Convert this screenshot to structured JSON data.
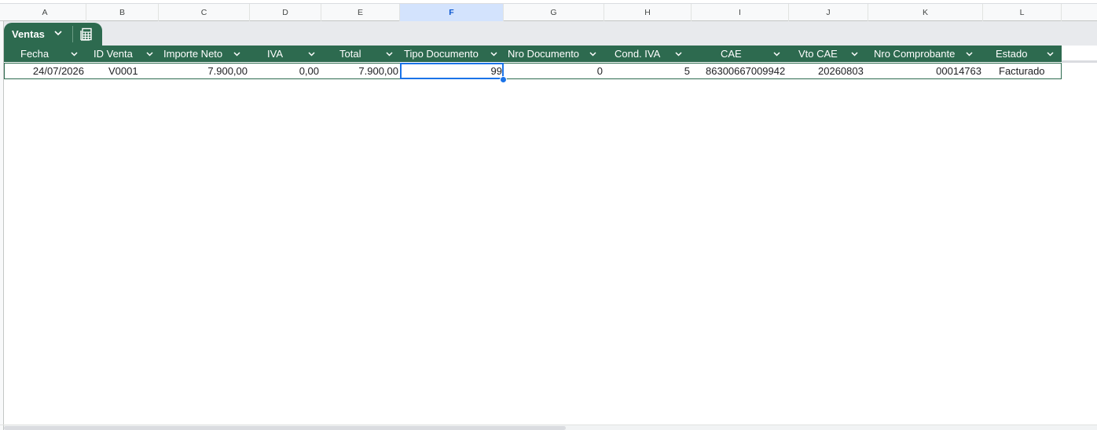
{
  "columns": {
    "letters": [
      "A",
      "B",
      "C",
      "D",
      "E",
      "F",
      "G",
      "H",
      "I",
      "J",
      "K",
      "L"
    ],
    "active": "F"
  },
  "table": {
    "name": "Ventas",
    "chevron_icon": "chevron-down-icon",
    "view_icon": "table-icon",
    "headers": [
      "Fecha",
      "ID Venta",
      "Importe Neto",
      "IVA",
      "Total",
      "Tipo Documento",
      "Nro Documento",
      "Cond. IVA",
      "CAE",
      "Vto CAE",
      "Nro Comprobante",
      "Estado"
    ],
    "rows": [
      [
        "24/07/2026",
        "V0001",
        "7.900,00",
        "0,00",
        "7.900,00",
        "99",
        "0",
        "5",
        "86300667009942",
        "20260803",
        "00014763",
        "Facturado"
      ]
    ]
  },
  "colors": {
    "table_header": "#2d6a4f",
    "selection": "#1a73e8",
    "active_column_header": "#d3e3fd"
  }
}
